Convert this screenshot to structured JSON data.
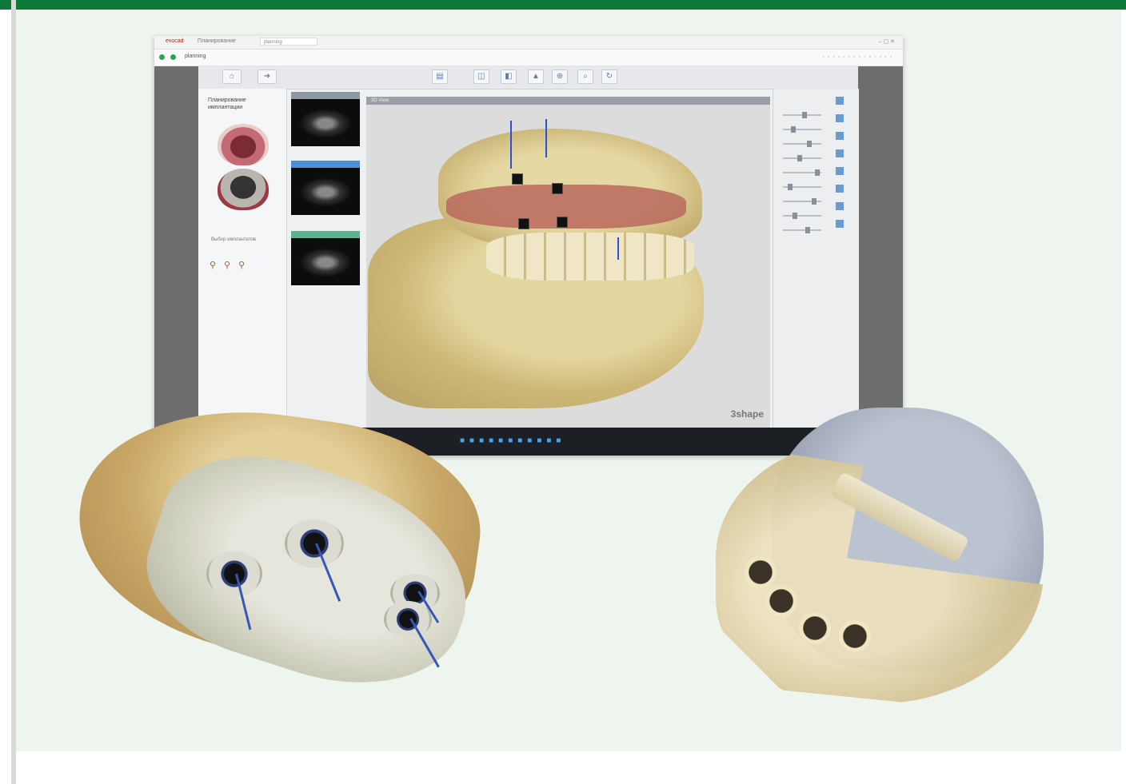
{
  "window": {
    "app_name": "exocad",
    "tab_title": "Планирование",
    "address_tab": "planning",
    "address": "planning",
    "controls": "–  ▢  ✕"
  },
  "toolbar": {
    "buttons": [
      "home",
      "next",
      "open",
      "view",
      "cursor",
      "zoom",
      "search",
      "rotate"
    ]
  },
  "left_panel": {
    "title": "Планирование имплантации",
    "sublabel": "Выбор имплантатов"
  },
  "viewport": {
    "header": "3D View",
    "watermark": "3shape"
  },
  "icons": {
    "taskbar": "taskbar-app-icons",
    "implant": "implant-icon"
  },
  "colors": {
    "brand_green": "#0d7a3a",
    "bone": "#d6c48a",
    "gum": "#b8685c",
    "drill_axis": "#2b4fd6"
  }
}
